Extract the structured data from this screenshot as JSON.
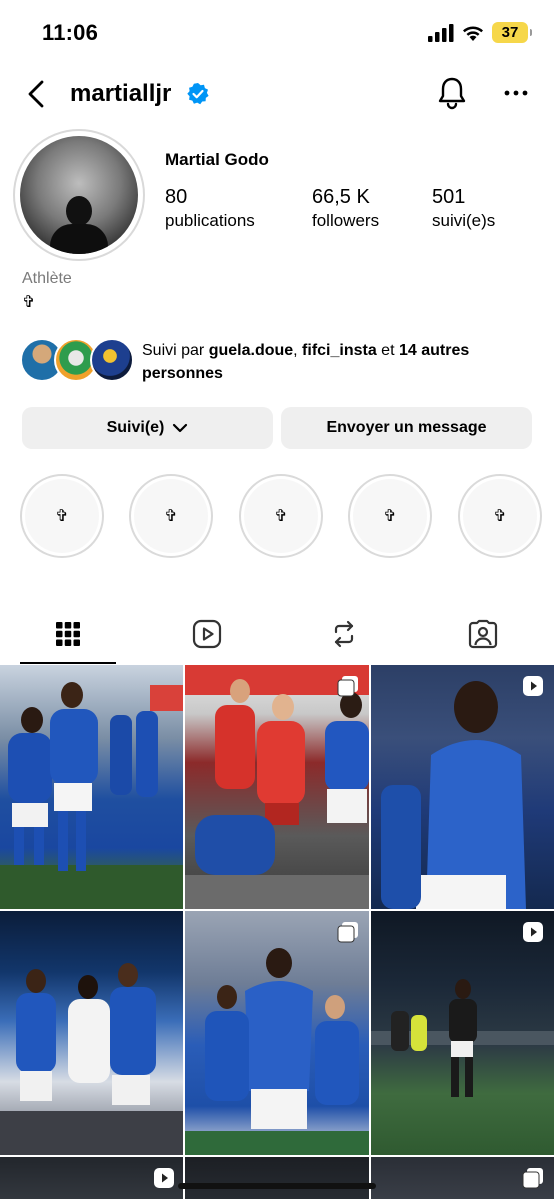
{
  "status_bar": {
    "time": "11:06",
    "battery": "37"
  },
  "header": {
    "username": "martialljr"
  },
  "profile": {
    "display_name": "Martial Godo",
    "stats": [
      {
        "value": "80",
        "label": "publications"
      },
      {
        "value": "66,5 K",
        "label": "followers"
      },
      {
        "value": "501",
        "label": "suivi(e)s"
      }
    ],
    "category": "Athlète",
    "bio": "✞"
  },
  "followed_by": {
    "prefix": "Suivi par ",
    "user1": "guela.doue",
    "sep": ", ",
    "user2": "fifci_insta",
    "mid": " et ",
    "others": "14 autres personnes"
  },
  "buttons": {
    "follow": "Suivi(e)",
    "message": "Envoyer un message"
  },
  "highlights": [
    "✞",
    "✞",
    "✞",
    "✞",
    "✞"
  ],
  "tabs": [
    "grid-icon",
    "reels-icon",
    "reposts-icon",
    "tagged-icon"
  ],
  "accent_color": "#0095f6"
}
